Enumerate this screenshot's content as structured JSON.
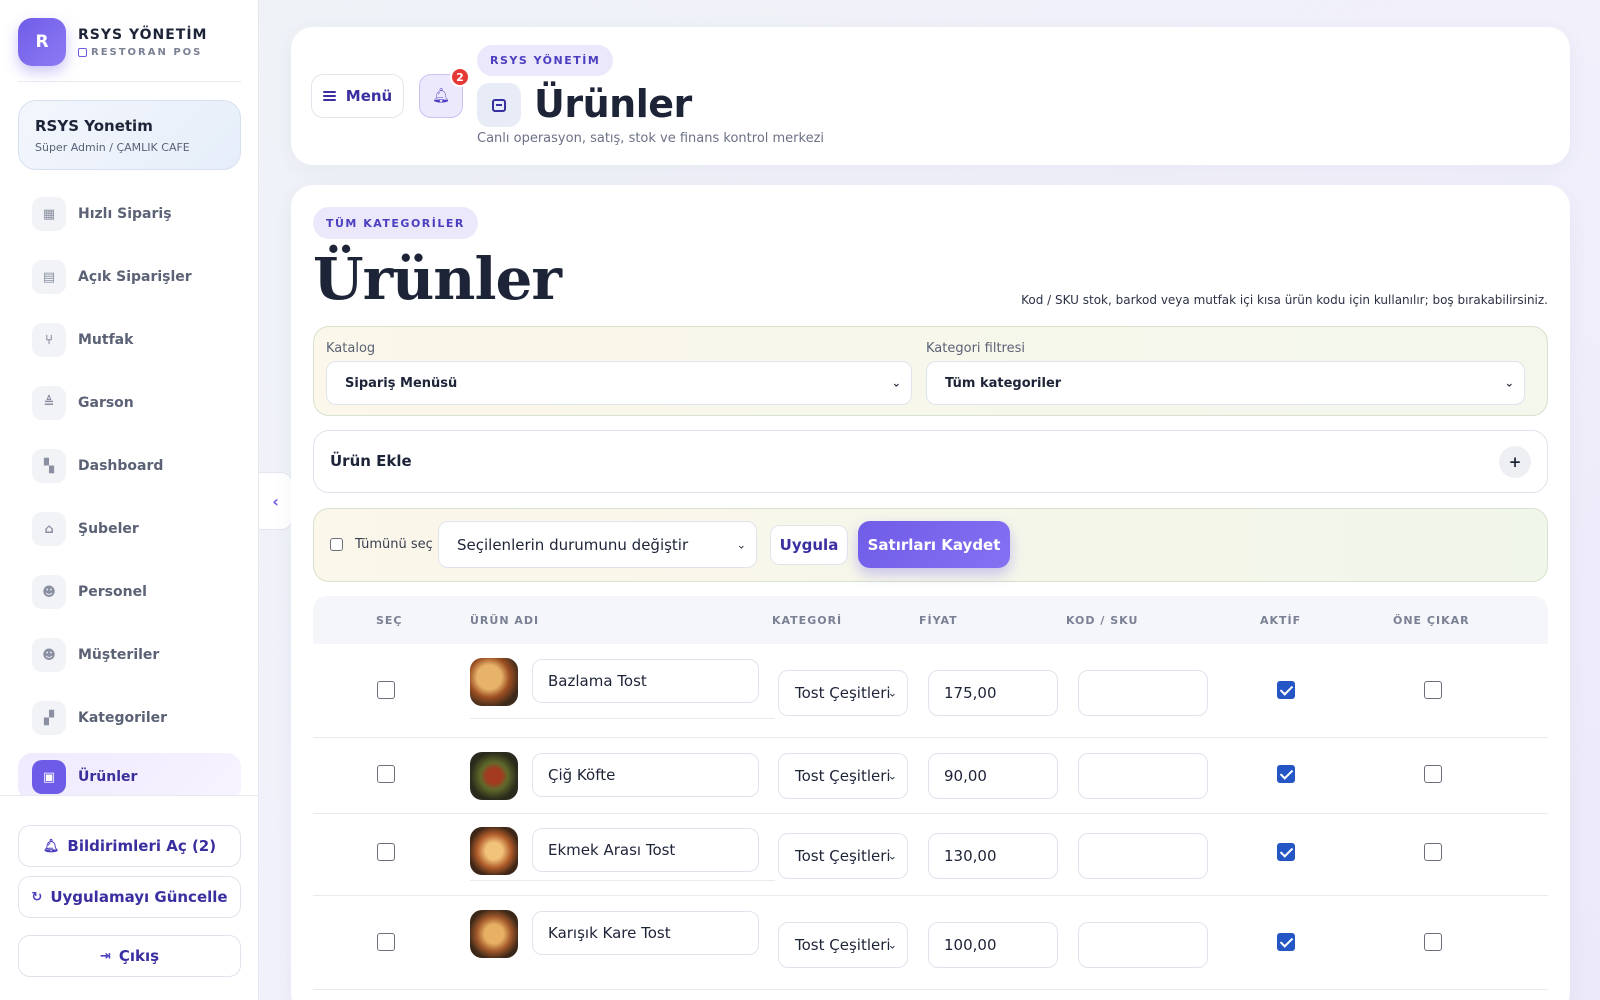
{
  "sidebar": {
    "logo_letter": "R",
    "brand_title": "RSYS YÖNETİM",
    "brand_sub": "RESTORAN POS",
    "user_name": "RSYS Yonetim",
    "user_role": "Süper Admin / ÇAMLIK CAFE",
    "items": [
      {
        "label": "Hızlı Sipariş",
        "icon": "calculator-icon"
      },
      {
        "label": "Açık Siparişler",
        "icon": "receipt-icon"
      },
      {
        "label": "Mutfak",
        "icon": "utensils-icon"
      },
      {
        "label": "Garson",
        "icon": "waiter-icon"
      },
      {
        "label": "Dashboard",
        "icon": "dashboard-icon"
      },
      {
        "label": "Şubeler",
        "icon": "store-icon"
      },
      {
        "label": "Personel",
        "icon": "users-icon"
      },
      {
        "label": "Müşteriler",
        "icon": "customers-icon"
      },
      {
        "label": "Kategoriler",
        "icon": "grid-icon"
      },
      {
        "label": "Ürünler",
        "icon": "box-icon",
        "active": true
      }
    ],
    "notifications_btn": "Bildirimleri Aç (2)",
    "update_btn": "Uygulamayı Güncelle",
    "logout_btn": "Çıkış"
  },
  "header": {
    "menu_label": "Menü",
    "bell_count": "2",
    "pill": "RSYS YÖNETİM",
    "title": "Ürünler",
    "subtitle": "Canlı operasyon, satış, stok ve finans kontrol merkezi"
  },
  "main": {
    "category_pill": "TÜM KATEGORİLER",
    "title": "Ürünler",
    "hint": "Kod / SKU stok, barkod veya mutfak içi kısa ürün kodu için kullanılır; boş bırakabilirsiniz.",
    "filters": {
      "catalog_label": "Katalog",
      "catalog_value": "Sipariş Menüsü",
      "category_label": "Kategori filtresi",
      "category_value": "Tüm kategoriler"
    },
    "add_label": "Ürün Ekle",
    "add_symbol": "+",
    "bulk": {
      "select_all_label": "Tümünü seç",
      "status_select": "Seçilenlerin durumunu değiştir",
      "apply_label": "Uygula",
      "save_label": "Satırları Kaydet"
    },
    "table": {
      "headers": [
        "SEÇ",
        "ÜRÜN ADI",
        "KATEGORİ",
        "FİYAT",
        "KOD / SKU",
        "AKTİF",
        "ÖNE ÇIKAR"
      ],
      "rows": [
        {
          "name": "Bazlama Tost",
          "category": "Tost Çeşitleri",
          "price": "175,00",
          "sku": "",
          "aktif": true,
          "one_cikar": false
        },
        {
          "name": "Çiğ Köfte",
          "category": "Tost Çeşitleri",
          "price": "90,00",
          "sku": "",
          "aktif": true,
          "one_cikar": false
        },
        {
          "name": "Ekmek Arası Tost",
          "category": "Tost Çeşitleri",
          "price": "130,00",
          "sku": "",
          "aktif": true,
          "one_cikar": false
        },
        {
          "name": "Karışık Kare Tost",
          "category": "Tost Çeşitleri",
          "price": "100,00",
          "sku": "",
          "aktif": true,
          "one_cikar": false
        }
      ]
    }
  },
  "colors": {
    "accent": "#6c5ce7",
    "accent_dark": "#3a2fa0",
    "badge_red": "#e53935",
    "checkbox_blue": "#2457c5"
  }
}
